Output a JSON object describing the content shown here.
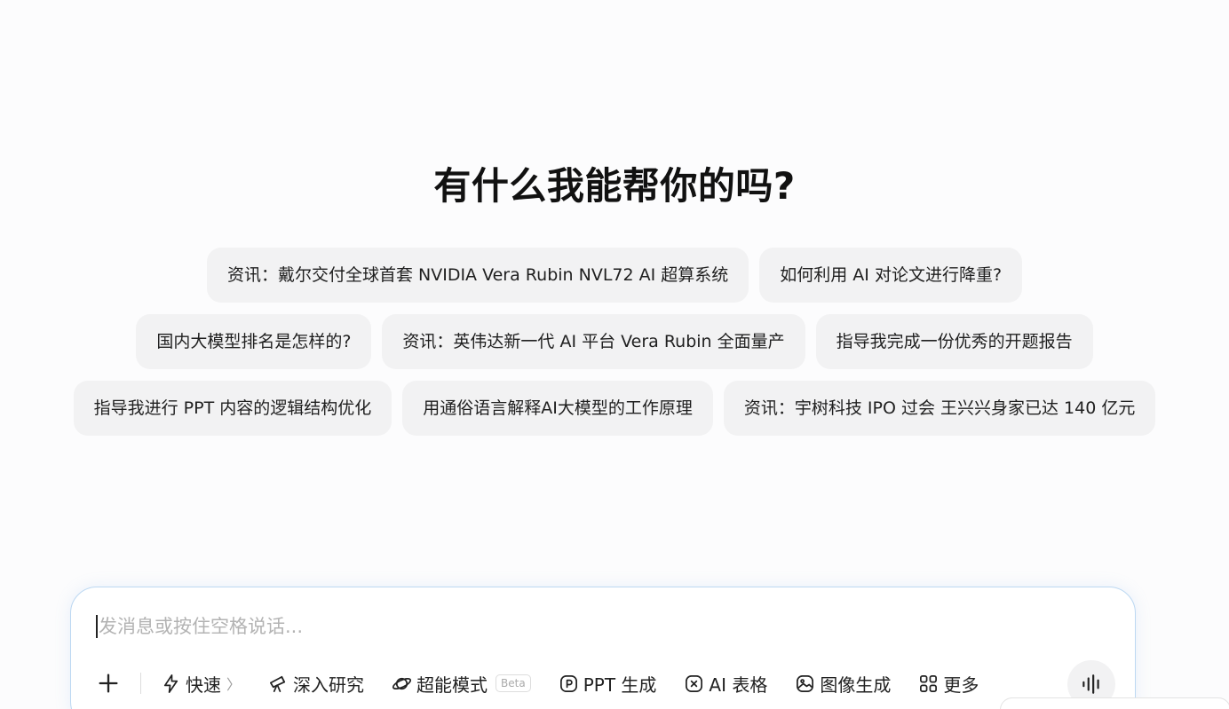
{
  "heading": "有什么我能帮你的吗?",
  "suggestions": [
    "资讯：戴尔交付全球首套 NVIDIA Vera Rubin NVL72 AI 超算系统",
    "如何利用 AI 对论文进行降重?",
    "国内大模型排名是怎样的?",
    "资讯：英伟达新一代 AI 平台 Vera Rubin 全面量产",
    "指导我完成一份优秀的开题报告",
    "指导我进行 PPT 内容的逻辑结构优化",
    "用通俗语言解释AI大模型的工作原理",
    "资讯：宇树科技 IPO 过会 王兴兴身家已达 140 亿元"
  ],
  "composer": {
    "placeholder": "发消息或按住空格说话...",
    "value": ""
  },
  "toolbar": {
    "fast": {
      "label": "快速",
      "chevron": "〉",
      "icon": "lightning-icon"
    },
    "deep_research": {
      "label": "深入研究",
      "icon": "telescope-icon"
    },
    "super_mode": {
      "label": "超能模式",
      "badge": "Beta",
      "icon": "planet-icon"
    },
    "ppt": {
      "label": "PPT 生成",
      "icon": "ppt-icon"
    },
    "ai_sheet": {
      "label": "AI 表格",
      "icon": "sheet-icon"
    },
    "image_gen": {
      "label": "图像生成",
      "icon": "image-icon"
    },
    "more": {
      "label": "更多",
      "icon": "grid-icon"
    }
  },
  "colors": {
    "background": "#fcfcfd",
    "chip_bg": "#f2f2f3",
    "composer_border": "#bcd8f2"
  }
}
